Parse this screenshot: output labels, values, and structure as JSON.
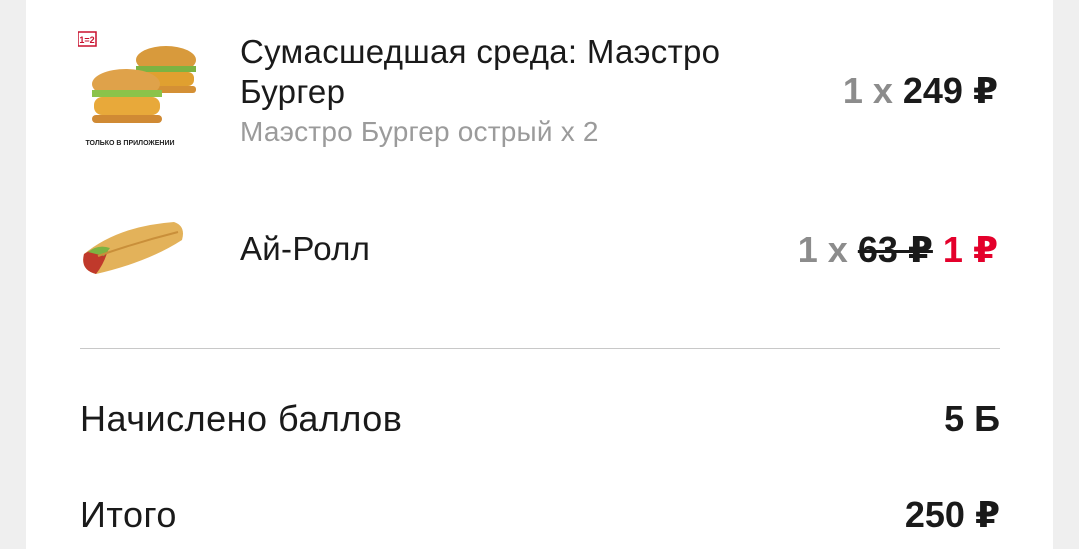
{
  "order_items": [
    {
      "name": "Сумасшедшая среда: Маэстро Бургер",
      "details": "Маэстро Бургер острый х 2",
      "quantity": "1 x",
      "price": "249 ₽",
      "badge": "1=2",
      "caption": "ТОЛЬКО В ПРИЛОЖЕНИИ",
      "icon": "burger-icon"
    },
    {
      "name": "Ай-Ролл",
      "quantity": "1 x",
      "old_price": "63 ₽",
      "price": "1 ₽",
      "icon": "wrap-roll-icon"
    }
  ],
  "summary": {
    "points_label": "Начислено баллов",
    "points_value": "5 Б",
    "total_label": "Итого",
    "total_value": "250 ₽"
  },
  "colors": {
    "accent": "#e4002b",
    "text": "#1a1a1a",
    "muted": "#9b9b9b",
    "background": "#efefef"
  }
}
